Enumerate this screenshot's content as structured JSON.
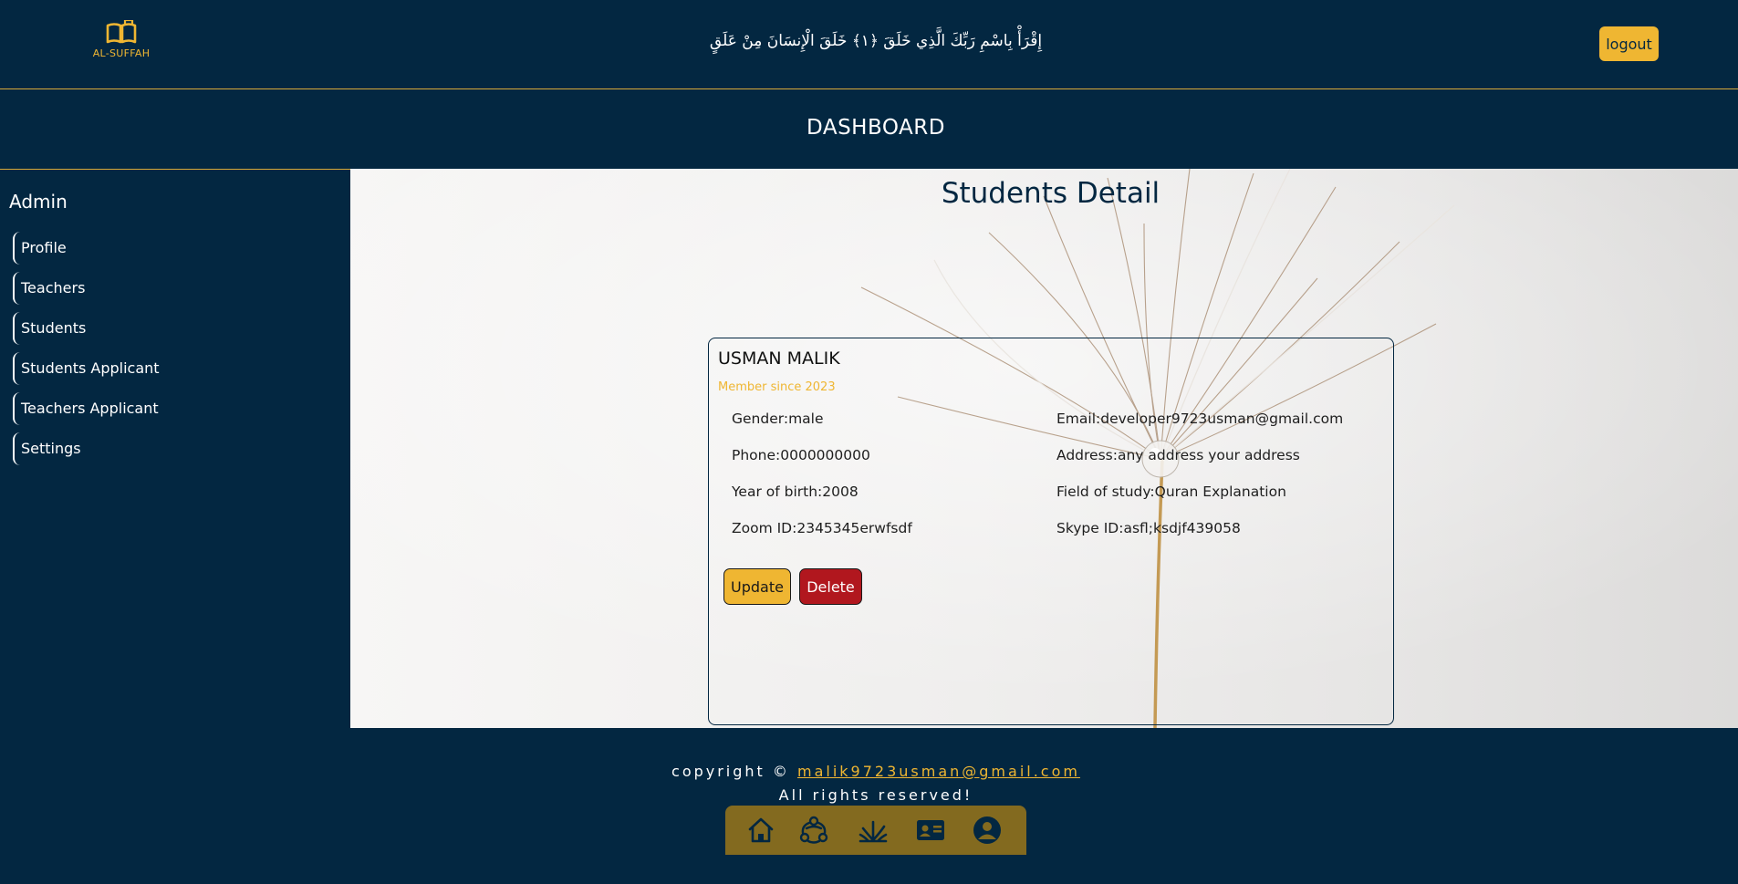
{
  "header": {
    "logo_text": "AL-SUFFAH",
    "ayah": "إِقْرَأْ بِاسْمِ رَبِّكَ الَّذِي خَلَقَ ﴿١﴾ خَلَقَ الْإِنسَانَ مِنْ عَلَقٍ",
    "logout_label": "logout"
  },
  "dashboard": {
    "title": "DASHBOARD"
  },
  "sidebar": {
    "title": "Admin",
    "items": [
      {
        "label": "Profile"
      },
      {
        "label": "Teachers"
      },
      {
        "label": "Students"
      },
      {
        "label": "Students Applicant"
      },
      {
        "label": "Teachers Applicant"
      },
      {
        "label": "Settings"
      }
    ]
  },
  "main": {
    "title": "Students Detail",
    "student": {
      "name": "USMAN MALIK",
      "member_since": "Member since 2023",
      "gender": "Gender:male",
      "email": "Email:developer9723usman@gmail.com",
      "phone": "Phone:0000000000",
      "address": "Address:any address your address",
      "year_of_birth": "Year of birth:2008",
      "field_of_study": "Field of study:Quran Explanation",
      "zoom_id": "Zoom ID:2345345erwfsdf",
      "skype_id": "Skype ID:asfl;ksdjf439058"
    },
    "update_label": "Update",
    "delete_label": "Delete"
  },
  "footer": {
    "copyright_prefix": "copyright © ",
    "email": "malik9723usman@gmail.com",
    "rights": "All rights reserved!"
  },
  "bottom_nav": {
    "icons": [
      "home-icon",
      "connections-icon",
      "grass-icon",
      "contact-card-icon",
      "account-icon"
    ]
  },
  "colors": {
    "navy": "#032741",
    "gold": "#efb632",
    "danger": "#b1171e",
    "nav_bar": "#836a1f"
  }
}
